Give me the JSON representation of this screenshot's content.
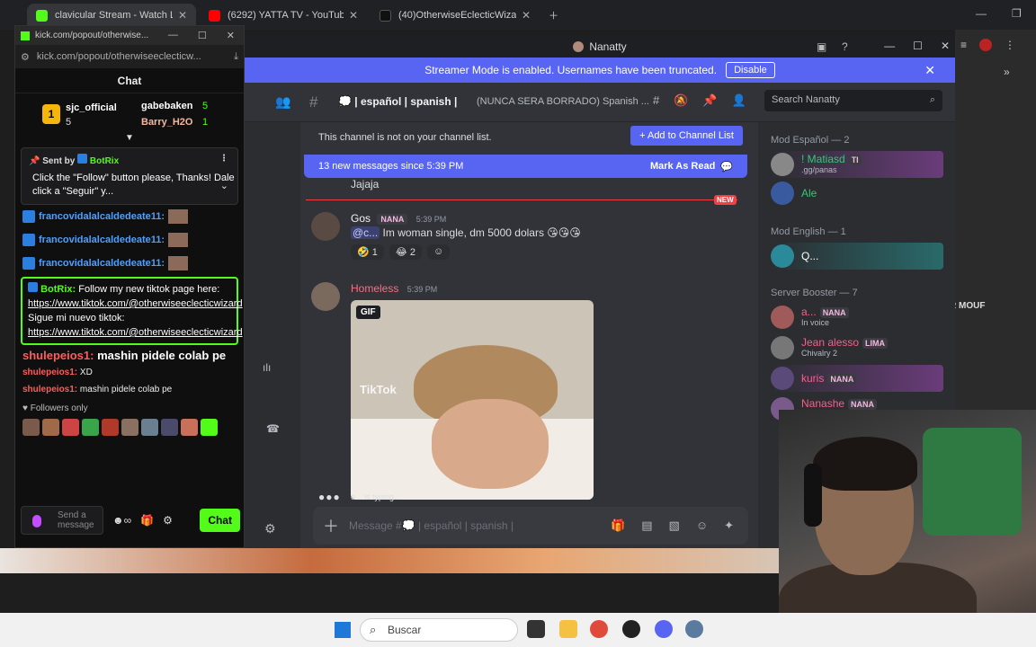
{
  "browser": {
    "tabs": [
      {
        "title": "clavicular Stream - Watch Live o",
        "color": "#53fc18"
      },
      {
        "title": "(6292) YATTA TV - YouTube",
        "color": "#ff0000"
      },
      {
        "title": "(40)OtherwiseEclecticWizard (@",
        "color": "#111111"
      }
    ]
  },
  "kick": {
    "title_url": "kick.com/popout/otherwise...",
    "address": "kick.com/popout/otherwiseeclecticw...",
    "chat_header": "Chat",
    "top_gifters": [
      {
        "name": "sjc_official",
        "count": "5"
      },
      {
        "name": "gabebaken",
        "count": "5"
      },
      {
        "name": "Barry_H2O",
        "count": "1"
      }
    ],
    "pinned": {
      "sent_by": "Sent by",
      "sender": "BotRix",
      "text": "Click the \"Follow\" button please, Thanks! Dale click a \"Seguir\" y..."
    },
    "repeat_user": "francovidalalcaldedeate11:",
    "bot_message": {
      "user": "BotRix:",
      "text1": "Follow my new tiktok page here:",
      "link1": "https://www.tiktok.com/@otherwiseeclecticwizard",
      "text2": "Sigue mi nuevo tiktok:",
      "link2": "https://www.tiktok.com/@otherwiseeclecticwizard"
    },
    "big_line": {
      "user": "shulepeios1:",
      "text": "mashin pidele colab pe"
    },
    "lines": [
      {
        "user": "shulepeios1:",
        "text": "XD"
      },
      {
        "user": "shulepeios1:",
        "text": "mashin pidele colab pe"
      }
    ],
    "followers_only": "Followers only",
    "input_placeholder": "Send a message",
    "chat_button": "Chat"
  },
  "discord": {
    "window_title": "Nanatty",
    "streamer_banner": "Streamer Mode is enabled. Usernames have been truncated.",
    "disable_button": "Disable",
    "channel_name": "| español | spanish |",
    "channel_topic": "(NUNCA SERA BORRADO) Spanish ...",
    "search_placeholder": "Search Nanatty",
    "not_on_list": "This channel is not on your channel list.",
    "add_to_list": "+ Add to Channel List",
    "new_messages": "13 new messages since 5:39 PM",
    "mark_as_read": "Mark As Read",
    "new_tag": "NEW",
    "prev_message": "Jajaja",
    "messages": [
      {
        "author": "Gos",
        "tag": "NANA",
        "time": "5:39 PM",
        "mention": "@c...",
        "text": "Im woman single, dm 5000 dolars 😘😘😘",
        "reactions": [
          {
            "emoji": "🤣",
            "count": "1"
          },
          {
            "emoji": "😂",
            "count": "2"
          }
        ]
      },
      {
        "author": "Homeless",
        "time": "5:39 PM",
        "gif_label": "GIF",
        "gif_watermark": "TikTok"
      }
    ],
    "typing": "e... is typing...",
    "message_placeholder": "Message #💭 | español | spanish |",
    "member_groups": [
      {
        "label": "Mod Español — 2"
      },
      {
        "label": "Mod English — 1"
      },
      {
        "label": "Server Booster — 7"
      }
    ],
    "members": [
      {
        "name": "! Matiasd",
        "tag": "TI",
        "status": ".gg/panas",
        "color": "#2ecc71"
      },
      {
        "name": "Ale",
        "tag": "",
        "status": "",
        "color": "#2ecc71"
      },
      {
        "name": "Q...",
        "tag": "",
        "status": "",
        "color": "#ffffff"
      },
      {
        "name": "a...",
        "tag": "NANA",
        "status": "In voice",
        "color": "#ff5c8a"
      },
      {
        "name": "Jean alesso",
        "tag": "LIMA",
        "status": "Chivalry 2",
        "color": "#ff5c8a"
      },
      {
        "name": "kuris",
        "tag": "NANA",
        "status": "",
        "color": "#ff5c8a"
      },
      {
        "name": "Nanashe",
        "tag": "NANA",
        "status": "",
        "color": "#ff5c8a"
      }
    ]
  },
  "taskbar": {
    "search": "Buscar"
  },
  "desktop_overlay": {
    "caption": "R MOUF"
  }
}
